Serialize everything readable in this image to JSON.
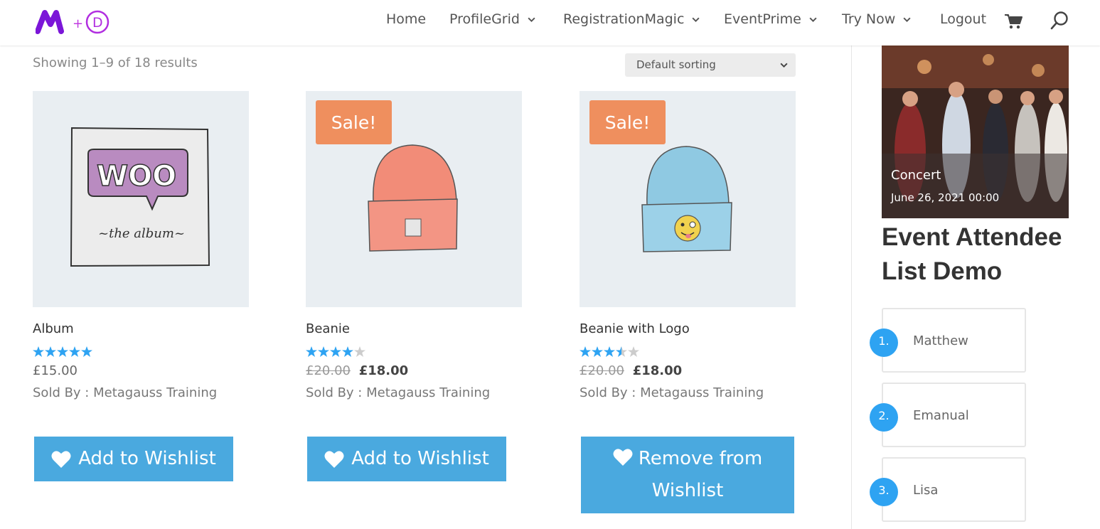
{
  "header": {
    "logo_alt": "M + D",
    "nav": [
      {
        "label": "Home",
        "has_dropdown": false
      },
      {
        "label": "ProfileGrid",
        "has_dropdown": true
      },
      {
        "label": "RegistrationMagic",
        "has_dropdown": true
      },
      {
        "label": "EventPrime",
        "has_dropdown": true
      },
      {
        "label": "Try Now",
        "has_dropdown": true
      },
      {
        "label": "Logout",
        "has_dropdown": false
      }
    ],
    "icons": [
      "cart-icon",
      "search-icon"
    ]
  },
  "shop": {
    "result_count": "Showing 1–9 of 18 results",
    "sorting": {
      "selected": "Default sorting"
    },
    "products": [
      {
        "name": "Album",
        "rating": 5,
        "price": "£15.00",
        "old_price": "",
        "sale": false,
        "sale_label": "",
        "sold_by": "Sold By : Metagauss Training",
        "wishlist_label": "Add to Wishlist"
      },
      {
        "name": "Beanie",
        "rating": 4,
        "price": "£18.00",
        "old_price": "£20.00",
        "sale": true,
        "sale_label": "Sale!",
        "sold_by": "Sold By : Metagauss Training",
        "wishlist_label": "Add to Wishlist"
      },
      {
        "name": "Beanie with Logo",
        "rating": 3.5,
        "price": "£18.00",
        "old_price": "£20.00",
        "sale": true,
        "sale_label": "Sale!",
        "sold_by": "Sold By : Metagauss Training",
        "wishlist_label": "Remove from Wishlist"
      }
    ]
  },
  "sidebar": {
    "event": {
      "name": "Concert",
      "date": "June 26, 2021 00:00"
    },
    "widget_title": "Event Attendee List Demo",
    "attendees": [
      {
        "num": "1.",
        "name": "Matthew"
      },
      {
        "num": "2.",
        "name": "Emanual"
      },
      {
        "num": "3.",
        "name": "Lisa"
      }
    ]
  },
  "colors": {
    "accent": "#2ea3f2",
    "button": "#4aa9df",
    "sale": "#ef8f5e",
    "logo_purple": "#7b16d8"
  }
}
